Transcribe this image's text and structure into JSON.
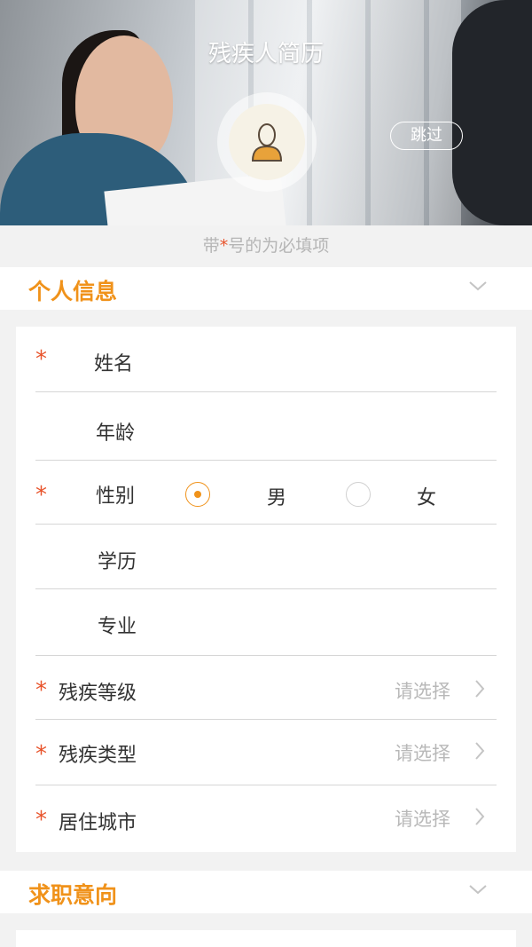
{
  "header": {
    "title": "残疾人简历",
    "skip_label": "跳过",
    "avatar_icon": "user-avatar-icon"
  },
  "note": {
    "prefix": "带",
    "star": "*",
    "suffix": "号的为必填项"
  },
  "sections": {
    "personal": {
      "title": "个人信息",
      "icon": "chevron-down-icon"
    },
    "intention": {
      "title": "求职意向",
      "icon": "chevron-down-icon"
    }
  },
  "form": {
    "required_mark": "*",
    "name": {
      "label": "姓名",
      "value": ""
    },
    "age": {
      "label": "年龄",
      "value": ""
    },
    "gender": {
      "label": "性别",
      "options": [
        "男",
        "女"
      ],
      "selected": "男"
    },
    "education": {
      "label": "学历",
      "value": ""
    },
    "major": {
      "label": "专业",
      "value": ""
    },
    "disability_level": {
      "label": "残疾等级",
      "placeholder": "请选择"
    },
    "disability_type": {
      "label": "残疾类型",
      "placeholder": "请选择"
    },
    "city": {
      "label": "居住城市",
      "placeholder": "请选择"
    }
  },
  "colors": {
    "accent": "#f0921a",
    "required": "#e8542c",
    "placeholder": "#b8b8b8",
    "text": "#333333"
  }
}
